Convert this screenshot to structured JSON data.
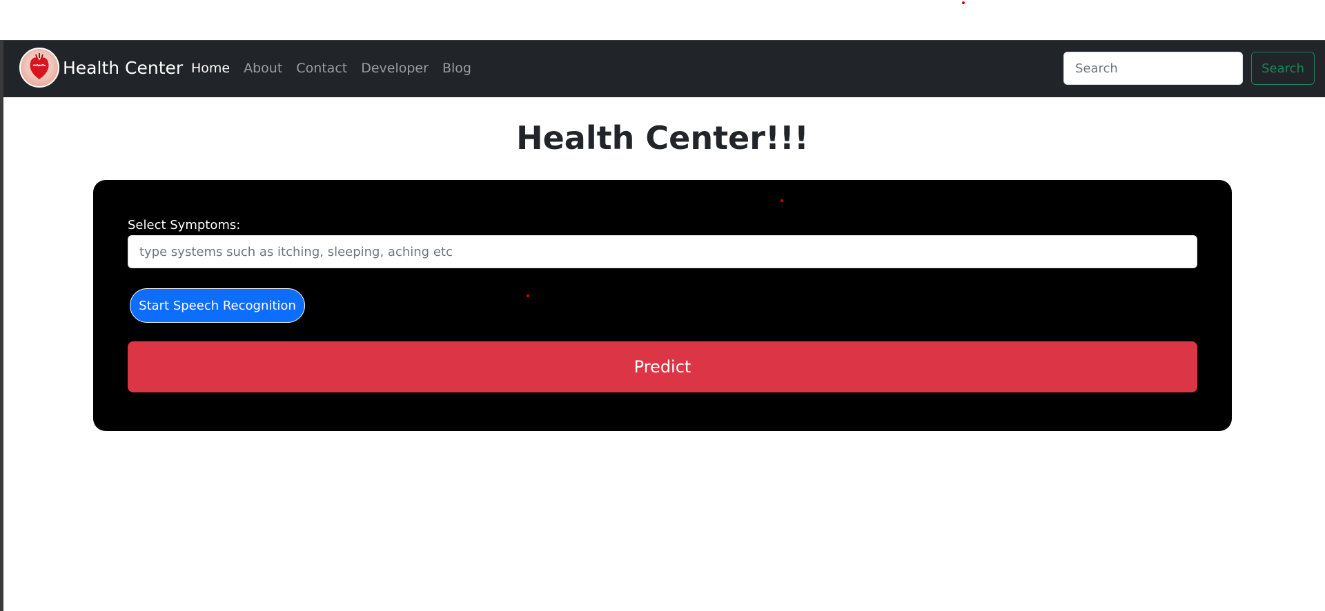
{
  "navbar": {
    "brand": "Health Center",
    "links": [
      {
        "label": "Home",
        "active": true
      },
      {
        "label": "About",
        "active": false
      },
      {
        "label": "Contact",
        "active": false
      },
      {
        "label": "Developer",
        "active": false
      },
      {
        "label": "Blog",
        "active": false
      }
    ],
    "search": {
      "placeholder": "Search",
      "value": "",
      "button_label": "Search"
    }
  },
  "main": {
    "title": "Health Center!!!",
    "form": {
      "symptoms_label": "Select Symptoms:",
      "symptoms_placeholder": "type systems such as itching, sleeping, aching etc",
      "symptoms_value": "",
      "speech_button_label": "Start Speech Recognition",
      "predict_button_label": "Predict"
    }
  },
  "colors": {
    "navbar_bg": "#212529",
    "card_bg": "#000000",
    "speech_button": "#0d6efd",
    "predict_button": "#dc3545",
    "search_button": "#198754"
  },
  "icons": {
    "logo": "heart-logo-icon"
  }
}
